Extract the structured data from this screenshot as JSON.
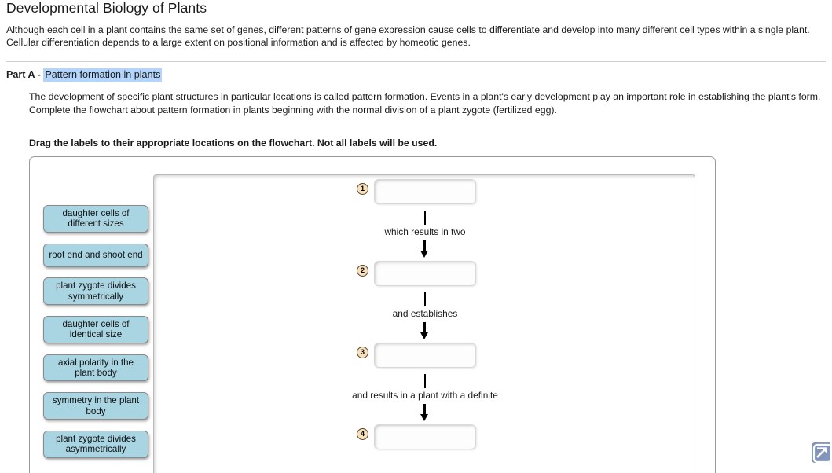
{
  "header": {
    "title": "Developmental Biology of Plants",
    "intro": "Although each cell in a plant contains the same set of genes, different patterns of gene expression cause cells to differentiate and develop into many different cell types within a single plant. Cellular differentiation depends to a large extent on positional information and is affected by homeotic genes."
  },
  "part": {
    "label": "Part A - ",
    "title": "Pattern formation in plants"
  },
  "prompt": {
    "paragraph1": "The development of specific plant structures in particular locations is called pattern formation. Events in a plant's early development play an important role in establishing the plant's form.",
    "paragraph2": "Complete the flowchart about pattern formation in plants beginning with the normal division of a plant zygote (fertilized egg).",
    "instruction": "Drag the labels to their appropriate locations on the flowchart. Not all labels will be used."
  },
  "label_bank": {
    "labels": [
      {
        "id": "label-daughter-cells-different-sizes",
        "text": "daughter cells of different sizes"
      },
      {
        "id": "label-root-end-shoot-end",
        "text": "root end and shoot end"
      },
      {
        "id": "label-zygote-divides-symmetrically",
        "text": "plant zygote divides symmetrically"
      },
      {
        "id": "label-daughter-cells-identical-size",
        "text": "daughter cells of identical size"
      },
      {
        "id": "label-axial-polarity",
        "text": "axial polarity in the plant body"
      },
      {
        "id": "label-symmetry-plant-body",
        "text": "symmetry in the plant body"
      },
      {
        "id": "label-zygote-divides-asymmetrically",
        "text": "plant zygote divides asymmetrically"
      }
    ]
  },
  "flowchart": {
    "steps": [
      {
        "number": "1",
        "value": ""
      },
      {
        "number": "2",
        "value": ""
      },
      {
        "number": "3",
        "value": ""
      },
      {
        "number": "4",
        "value": ""
      }
    ],
    "connectors": [
      {
        "caption": "which results in two"
      },
      {
        "caption": "and establishes"
      },
      {
        "caption": "and results in a plant with a definite"
      }
    ]
  },
  "colors": {
    "label_fill": "#a9d4e2",
    "badge_fill": "#f6dfbb",
    "badge_border": "#5a4326",
    "highlight": "#b4d5fb",
    "expand_icon_bg": "#8296bd"
  },
  "expand_button": {
    "icon": "expand-arrow-icon"
  }
}
